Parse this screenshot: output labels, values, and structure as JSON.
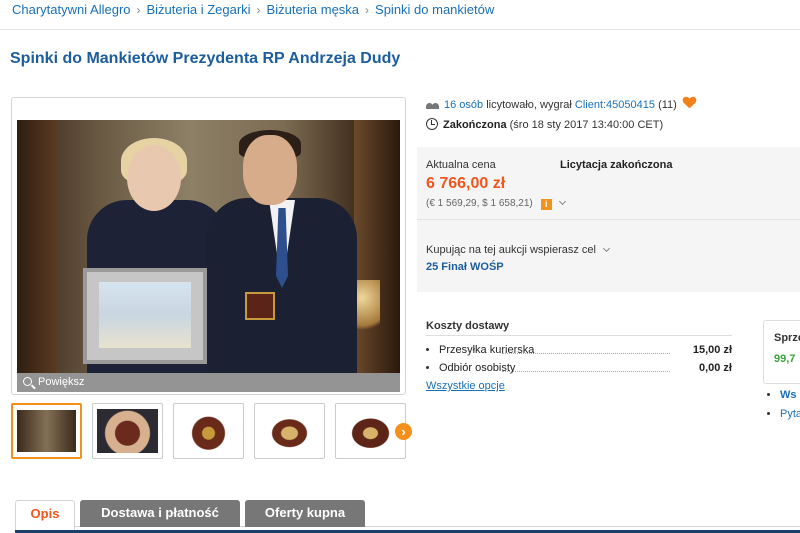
{
  "breadcrumb": [
    "Charytatywni Allegro",
    "Biżuteria i Zegarki",
    "Biżuteria męska",
    "Spinki do mankietów"
  ],
  "breadcrumb_separator": "›",
  "title": "Spinki do Mankietów Prezydenta RP Andrzeja Dudy",
  "gallery": {
    "zoom_label": "Powiększ",
    "thumbnail_count": 5,
    "next_icon": "chevron-right-icon"
  },
  "bidders": {
    "count_link": "16 osób",
    "text": "licytowało, wygrał",
    "winner_link": "Client:45050415",
    "winner_rating": "(11)"
  },
  "status": {
    "label": "Zakończona",
    "date": "(śro 18 sty 2017 13:40:00 CET)"
  },
  "price": {
    "label": "Aktualna cena",
    "value": "6 766,00 zł",
    "fx": "(€ 1 569,29, $ 1 658,21)",
    "info_icon_text": "i",
    "auction_status": "Licytacja zakończona"
  },
  "charity": {
    "support_text": "Kupując na tej aukcji wspierasz cel",
    "name": "25 Finał WOŚP"
  },
  "shipping": {
    "title": "Koszty dostawy",
    "rows": [
      {
        "name": "Przesyłka kurierska",
        "price": "15,00 zł"
      },
      {
        "name": "Odbiór osobisty",
        "price": "0,00 zł"
      }
    ],
    "all_options": "Wszystkie opcje"
  },
  "seller": {
    "label_partial": "Sprze",
    "rating_partial": "99,7",
    "links": [
      "Ws",
      "Pyta"
    ]
  },
  "tabs": [
    "Opis",
    "Dostawa i płatność",
    "Oferty kupna"
  ],
  "colors": {
    "accent_orange": "#f0561e",
    "link_blue": "#1a70b8",
    "title_blue": "#1c5d9c"
  }
}
